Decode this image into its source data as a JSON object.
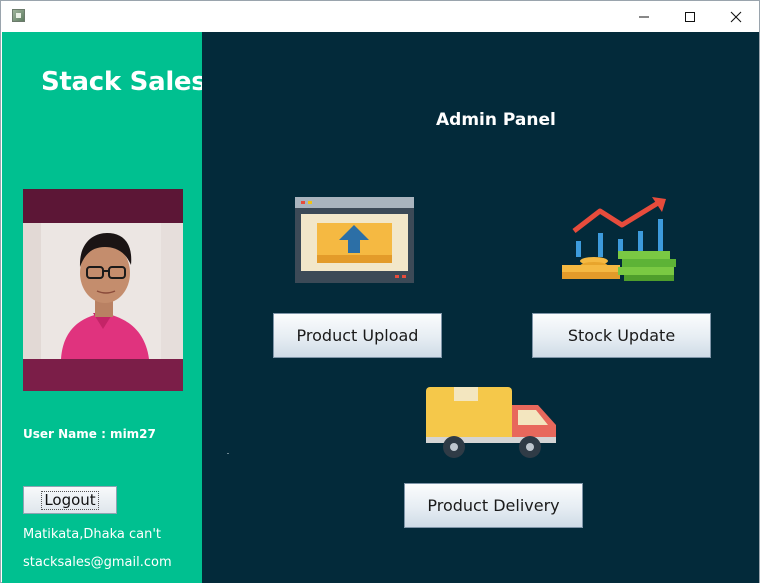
{
  "window": {
    "icons": {
      "app": "app-icon",
      "minimize": "minimize-icon",
      "maximize": "maximize-icon",
      "close": "close-icon"
    }
  },
  "sidebar": {
    "brand": "Stack Sales",
    "username_label": "User Name : mim27",
    "logout_label": "Logout",
    "address": "Matikata,Dhaka can't",
    "email": "stacksales@gmail.com",
    "colors": {
      "background": "#00c090",
      "text": "#ffffff"
    }
  },
  "main": {
    "title": "Admin Panel",
    "colors": {
      "background": "#032a3a"
    },
    "actions": [
      {
        "label": "Product Upload",
        "icon": "upload-window-icon"
      },
      {
        "label": "Stock Update",
        "icon": "stock-growth-icon"
      },
      {
        "label": "Product Delivery",
        "icon": "delivery-truck-icon"
      }
    ]
  }
}
